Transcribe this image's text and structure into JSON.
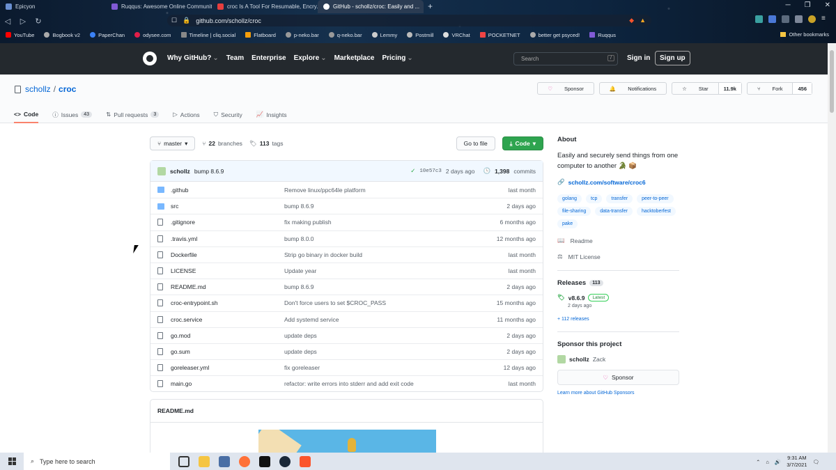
{
  "browser": {
    "tabs": [
      {
        "title": "Epicyon",
        "color": "#6a8fd1"
      },
      {
        "title": "Ruqqus: Awesome Online Communiti...",
        "color": "#805ad5"
      },
      {
        "title": "croc Is A Tool For Resumable, Encry...",
        "color": "#e53e3e"
      },
      {
        "title": "GitHub - schollz/croc: Easily and ...",
        "color": "#ffffff"
      }
    ],
    "url": "github.com/schollz/croc",
    "bookmarks": [
      "YouTube",
      "Bogbook v2",
      "PaperChan",
      "odysee.com",
      "Timeline | cliq.social",
      "Flatboard",
      "p-neko.bar",
      "q-neko.bar",
      "Lemmy",
      "Postmill",
      "VRChat",
      "POCKETNET",
      "better get psyced!",
      "Ruqqus"
    ],
    "other_bookmarks": "Other bookmarks"
  },
  "gh_header": {
    "nav": [
      "Why GitHub?",
      "Team",
      "Enterprise",
      "Explore",
      "Marketplace",
      "Pricing"
    ],
    "search_placeholder": "Search",
    "slash": "/",
    "sign_in": "Sign in",
    "sign_up": "Sign up"
  },
  "repo": {
    "owner": "schollz",
    "name": "croc",
    "sponsor": "Sponsor",
    "notifications": "Notifications",
    "star": "Star",
    "star_count": "11.9k",
    "fork": "Fork",
    "fork_count": "456",
    "tabs": [
      {
        "label": "Code",
        "count": ""
      },
      {
        "label": "Issues",
        "count": "43"
      },
      {
        "label": "Pull requests",
        "count": "3"
      },
      {
        "label": "Actions",
        "count": ""
      },
      {
        "label": "Security",
        "count": ""
      },
      {
        "label": "Insights",
        "count": ""
      }
    ]
  },
  "code": {
    "branch": "master",
    "branches_count": "22",
    "branches_label": "branches",
    "tags_count": "113",
    "tags_label": "tags",
    "go_to_file": "Go to file",
    "code_btn": "Code",
    "commit": {
      "author": "schollz",
      "message": "bump 8.6.9",
      "hash": "10e57c3",
      "time": "2 days ago",
      "commits_count": "1,398",
      "commits_label": "commits"
    },
    "files": [
      {
        "type": "dir",
        "name": ".github",
        "msg": "Remove linux/ppc64le platform",
        "time": "last month"
      },
      {
        "type": "dir",
        "name": "src",
        "msg": "bump 8.6.9",
        "time": "2 days ago"
      },
      {
        "type": "file",
        "name": ".gitignore",
        "msg": "fix making publish",
        "time": "6 months ago"
      },
      {
        "type": "file",
        "name": ".travis.yml",
        "msg": "bump 8.0.0",
        "time": "12 months ago"
      },
      {
        "type": "file",
        "name": "Dockerfile",
        "msg": "Strip go binary in docker build",
        "time": "last month"
      },
      {
        "type": "file",
        "name": "LICENSE",
        "msg": "Update year",
        "time": "last month"
      },
      {
        "type": "file",
        "name": "README.md",
        "msg": "bump 8.6.9",
        "time": "2 days ago"
      },
      {
        "type": "file",
        "name": "croc-entrypoint.sh",
        "msg": "Don't force users to set $CROC_PASS",
        "time": "15 months ago"
      },
      {
        "type": "file",
        "name": "croc.service",
        "msg": "Add systemd service",
        "time": "11 months ago"
      },
      {
        "type": "file",
        "name": "go.mod",
        "msg": "update deps",
        "time": "2 days ago"
      },
      {
        "type": "file",
        "name": "go.sum",
        "msg": "update deps",
        "time": "2 days ago"
      },
      {
        "type": "file",
        "name": "goreleaser.yml",
        "msg": "fix goreleaser",
        "time": "12 days ago"
      },
      {
        "type": "file",
        "name": "main.go",
        "msg": "refactor: write errors into stderr and add exit code",
        "time": "last month"
      }
    ],
    "readme_title": "README.md"
  },
  "sidebar": {
    "about": "About",
    "description": "Easily and securely send things from one computer to another 🐊 📦",
    "website": "schollz.com/software/croc6",
    "topics": [
      "golang",
      "tcp",
      "transfer",
      "peer-to-peer",
      "file-sharing",
      "data-transfer",
      "hacktoberfest",
      "pake"
    ],
    "readme": "Readme",
    "license": "MIT License",
    "releases": "Releases",
    "releases_count": "113",
    "release_tag": "v8.6.9",
    "latest": "Latest",
    "release_time": "2 days ago",
    "more_releases": "+ 112 releases",
    "sponsor_title": "Sponsor this project",
    "sponsor_user": "schollz",
    "sponsor_name": "Zack",
    "sponsor_btn": "Sponsor",
    "learn_more": "Learn more about GitHub Sponsors"
  },
  "taskbar": {
    "search_placeholder": "Type here to search",
    "time": "9:31 AM",
    "date": "3/7/2021"
  }
}
